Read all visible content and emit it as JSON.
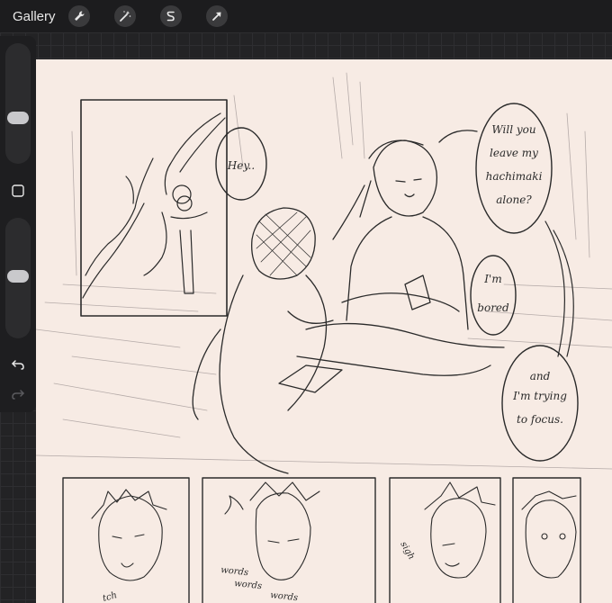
{
  "topbar": {
    "gallery_label": "Gallery",
    "tools": [
      {
        "icon": "wrench-icon"
      },
      {
        "icon": "magic-wand-icon"
      },
      {
        "icon": "selection-s-icon"
      },
      {
        "icon": "transform-arrow-icon"
      }
    ]
  },
  "sidebar": {
    "brush_size_level": 0.5,
    "opacity_level": 0.5,
    "buttons": [
      "modify-square-icon",
      "undo-icon",
      "redo-icon"
    ]
  },
  "canvas": {
    "background": "#f7ebe4",
    "speech_bubbles": {
      "hey": "Hey..",
      "will_line1": "Will you",
      "will_line2": "leave my",
      "will_line3": "hachimaki",
      "will_line4": "alone?",
      "bored_line1": "I'm",
      "bored_line2": "bored",
      "focus_line1": "and",
      "focus_line2": "I'm trying",
      "focus_line3": "to focus."
    },
    "sfx": {
      "words1": "words",
      "words2": "words",
      "words3": "words",
      "sigh": "sigh",
      "tch": "tch"
    }
  },
  "colors": {
    "topbar": "#1c1c1e",
    "workspace": "#232325",
    "ink": "#2a2a2a"
  }
}
